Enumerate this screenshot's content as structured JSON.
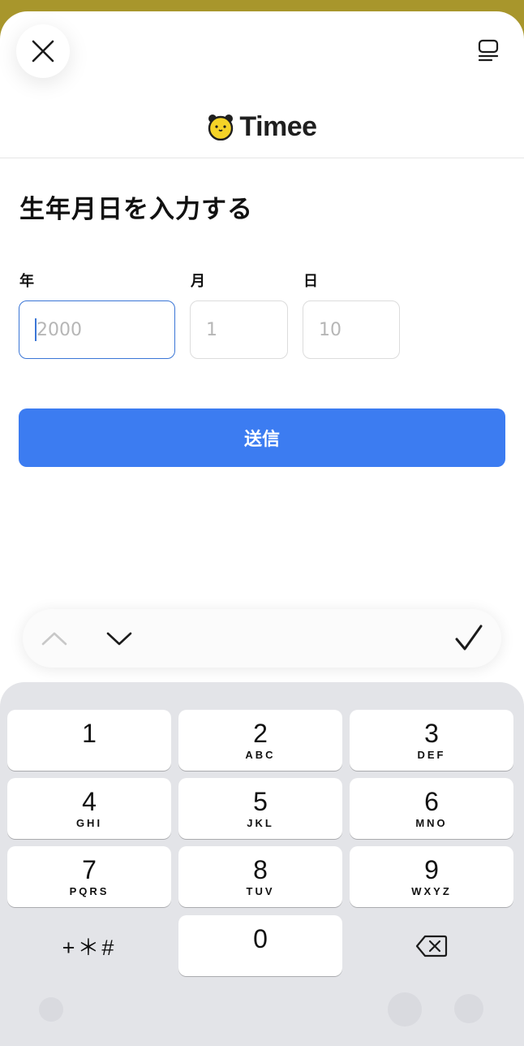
{
  "header": {
    "close_icon": "close-icon",
    "menu_icon": "tabs-menu-icon",
    "brand_name": "Timee",
    "brand_logo": "bear-face-logo",
    "brand_color": "#f5d327"
  },
  "form": {
    "title": "生年月日を入力する",
    "fields": [
      {
        "label": "年",
        "placeholder": "2000",
        "value": ""
      },
      {
        "label": "月",
        "placeholder": "1",
        "value": ""
      },
      {
        "label": "日",
        "placeholder": "10",
        "value": ""
      }
    ],
    "submit_label": "送信",
    "accent_color": "#3c7cf1"
  },
  "accessory_bar": {
    "previous_icon": "chevron-up-icon",
    "next_icon": "chevron-down-icon",
    "done_icon": "checkmark-icon"
  },
  "keypad": {
    "keys": [
      {
        "digit": "1",
        "letters": ""
      },
      {
        "digit": "2",
        "letters": "ABC"
      },
      {
        "digit": "3",
        "letters": "DEF"
      },
      {
        "digit": "4",
        "letters": "GHI"
      },
      {
        "digit": "5",
        "letters": "JKL"
      },
      {
        "digit": "6",
        "letters": "MNO"
      },
      {
        "digit": "7",
        "letters": "PQRS"
      },
      {
        "digit": "8",
        "letters": "TUV"
      },
      {
        "digit": "9",
        "letters": "WXYZ"
      },
      {
        "digit": "0",
        "letters": ""
      }
    ],
    "symbols_label": "+＊#",
    "delete_icon": "backspace-icon"
  }
}
